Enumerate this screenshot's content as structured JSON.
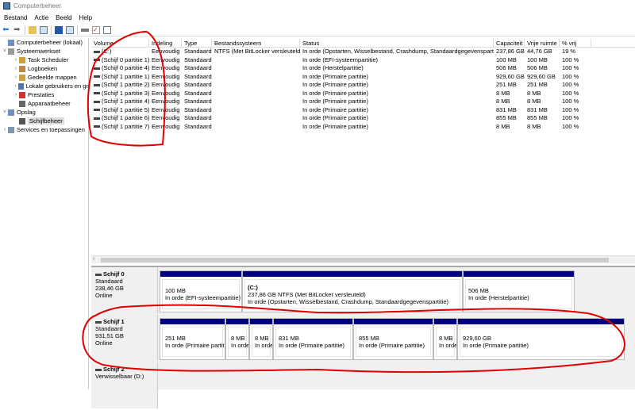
{
  "window": {
    "title": "Computerbeheer"
  },
  "menu": [
    "Bestand",
    "Actie",
    "Beeld",
    "Help"
  ],
  "tree": [
    {
      "label": "Computerbeheer (lokaal)",
      "level": 0,
      "chev": ""
    },
    {
      "label": "Systeemwerkset",
      "level": 0,
      "chev": "˅"
    },
    {
      "label": "Task Scheduler",
      "level": 1,
      "chev": "›"
    },
    {
      "label": "Logboeken",
      "level": 1,
      "chev": "›"
    },
    {
      "label": "Gedeelde mappen",
      "level": 1,
      "chev": "›"
    },
    {
      "label": "Lokale gebruikers en gr",
      "level": 1,
      "chev": "›"
    },
    {
      "label": "Prestaties",
      "level": 1,
      "chev": "›"
    },
    {
      "label": "Apparaatbeheer",
      "level": 1,
      "chev": ""
    },
    {
      "label": "Opslag",
      "level": 0,
      "chev": "˅"
    },
    {
      "label": "Schijfbeheer",
      "level": 1,
      "chev": "",
      "selected": true
    },
    {
      "label": "Services en toepassingen",
      "level": 0,
      "chev": "›"
    }
  ],
  "table": {
    "headers": [
      "Volume",
      "Indeling",
      "Type",
      "Bestandssysteem",
      "Status",
      "Capaciteit",
      "Vrije ruimte",
      "% vrij"
    ],
    "rows": [
      [
        "(C:)",
        "Eenvoudig",
        "Standaard",
        "NTFS (Met BitLocker versleuteld)",
        "In orde (Opstarten, Wisselbestand, Crashdump, Standaardgegevenspartitie)",
        "237,86 GB",
        "44,76 GB",
        "19 %"
      ],
      [
        "(Schijf 0 partitie 1)",
        "Eenvoudig",
        "Standaard",
        "",
        "In orde (EFI-systeempartitie)",
        "100 MB",
        "100 MB",
        "100 %"
      ],
      [
        "(Schijf 0 partitie 4)",
        "Eenvoudig",
        "Standaard",
        "",
        "In orde (Herstelpartitie)",
        "506 MB",
        "506 MB",
        "100 %"
      ],
      [
        "(Schijf 1 partitie 1)",
        "Eenvoudig",
        "Standaard",
        "",
        "In orde (Primaire partitie)",
        "929,60 GB",
        "929,60 GB",
        "100 %"
      ],
      [
        "(Schijf 1 partitie 2)",
        "Eenvoudig",
        "Standaard",
        "",
        "In orde (Primaire partitie)",
        "251 MB",
        "251 MB",
        "100 %"
      ],
      [
        "(Schijf 1 partitie 3)",
        "Eenvoudig",
        "Standaard",
        "",
        "In orde (Primaire partitie)",
        "8 MB",
        "8 MB",
        "100 %"
      ],
      [
        "(Schijf 1 partitie 4)",
        "Eenvoudig",
        "Standaard",
        "",
        "In orde (Primaire partitie)",
        "8 MB",
        "8 MB",
        "100 %"
      ],
      [
        "(Schijf 1 partitie 5)",
        "Eenvoudig",
        "Standaard",
        "",
        "In orde (Primaire partitie)",
        "831 MB",
        "831 MB",
        "100 %"
      ],
      [
        "(Schijf 1 partitie 6)",
        "Eenvoudig",
        "Standaard",
        "",
        "In orde (Primaire partitie)",
        "855 MB",
        "855 MB",
        "100 %"
      ],
      [
        "(Schijf 1 partitie 7)",
        "Eenvoudig",
        "Standaard",
        "",
        "In orde (Primaire partitie)",
        "8 MB",
        "8 MB",
        "100 %"
      ]
    ]
  },
  "disks": [
    {
      "name": "Schijf 0",
      "type": "Standaard",
      "size": "238,46 GB",
      "state": "Online",
      "partitions": [
        {
          "title": "",
          "size": "100 MB",
          "status": "In orde (EFI-systeempartitie)"
        },
        {
          "title": "(C:)",
          "size": "237,86 GB NTFS (Met BitLocker versleuteld)",
          "status": "In orde (Opstarten, Wisselbestand, Crashdump, Standaardgegevenspartitie)"
        },
        {
          "title": "",
          "size": "506 MB",
          "status": "In orde (Herstelpartitie)"
        }
      ]
    },
    {
      "name": "Schijf 1",
      "type": "Standaard",
      "size": "931,51 GB",
      "state": "Online",
      "partitions": [
        {
          "title": "",
          "size": "251 MB",
          "status": "In orde (Primaire partiti"
        },
        {
          "title": "",
          "size": "8 MB",
          "status": "In orde"
        },
        {
          "title": "",
          "size": "8 MB",
          "status": "In orde"
        },
        {
          "title": "",
          "size": "831 MB",
          "status": "In orde (Primaire partitie)"
        },
        {
          "title": "",
          "size": "855 MB",
          "status": "In orde (Primaire partitie)"
        },
        {
          "title": "",
          "size": "8 MB",
          "status": "In orde"
        },
        {
          "title": "",
          "size": "929,60 GB",
          "status": "In orde (Primaire partitie)"
        }
      ]
    },
    {
      "name": "Schijf 2",
      "type": "Verwisselbaar (D:)",
      "partitions": []
    }
  ],
  "colors": {
    "partition_bar": "#00007f",
    "annotation": "#e00000"
  }
}
